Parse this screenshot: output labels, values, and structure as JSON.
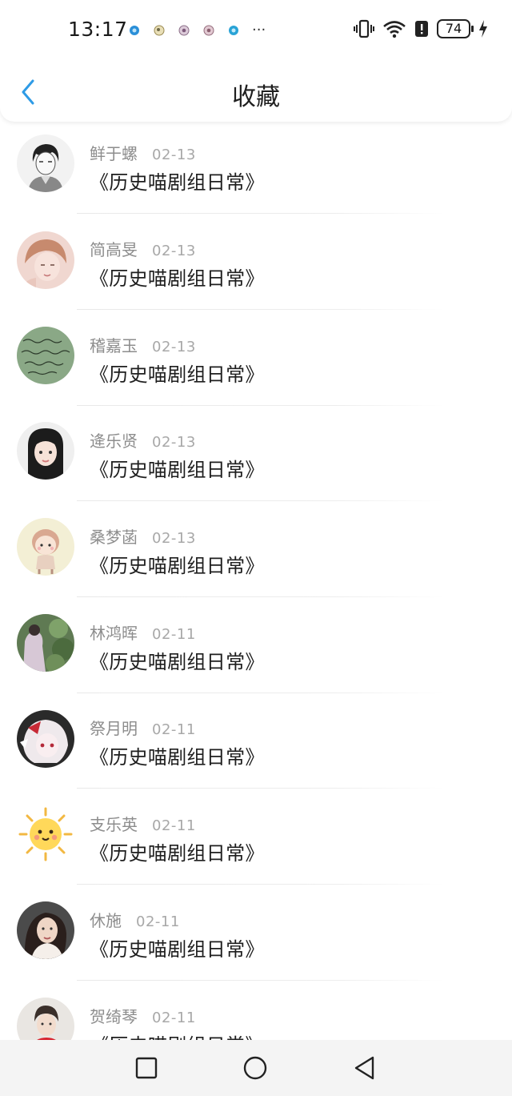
{
  "status_bar": {
    "time": "13:17",
    "battery": "74",
    "more": "···",
    "notification_colors": [
      "#2a8fd8",
      "#c9b36a",
      "#b48fae",
      "#b6889a",
      "#29a3d6"
    ]
  },
  "header": {
    "title": "收藏",
    "back_icon": "chevron-left-icon",
    "accent": "#2e9be6"
  },
  "favorites": [
    {
      "user": "鲜于螺",
      "date": "02-13",
      "work": "《历史喵剧组日常》",
      "avatar": "sketch-portrait"
    },
    {
      "user": "简高旻",
      "date": "02-13",
      "work": "《历史喵剧组日常》",
      "avatar": "pink-portrait"
    },
    {
      "user": "稽嘉玉",
      "date": "02-13",
      "work": "《历史喵剧组日常》",
      "avatar": "chalkboard-text"
    },
    {
      "user": "逄乐贤",
      "date": "02-13",
      "work": "《历史喵剧组日常》",
      "avatar": "girl-portrait"
    },
    {
      "user": "桑梦菡",
      "date": "02-13",
      "work": "《历史喵剧组日常》",
      "avatar": "cartoon-girl"
    },
    {
      "user": "林鸿晖",
      "date": "02-11",
      "work": "《历史喵剧组日常》",
      "avatar": "garden-photo"
    },
    {
      "user": "祭月明",
      "date": "02-11",
      "work": "《历史喵剧组日常》",
      "avatar": "anime-white-hair"
    },
    {
      "user": "支乐英",
      "date": "02-11",
      "work": "《历史喵剧组日常》",
      "avatar": "sun-emoji"
    },
    {
      "user": "休施",
      "date": "02-11",
      "work": "《历史喵剧组日常》",
      "avatar": "woman-portrait"
    },
    {
      "user": "贺绮琴",
      "date": "02-11",
      "work": "《历史喵剧组日常》",
      "avatar": "man-red-shirt"
    }
  ],
  "nav": {
    "recents_icon": "square-icon",
    "home_icon": "circle-icon",
    "back_icon": "triangle-back-icon"
  }
}
